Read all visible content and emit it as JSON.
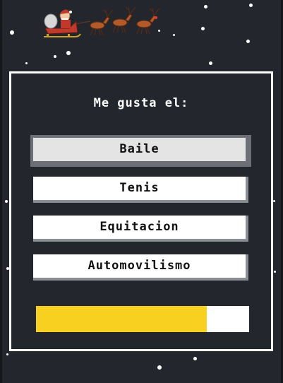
{
  "banner": {
    "icon": "santa-sleigh-reindeer-icon"
  },
  "quiz": {
    "question": "Me gusta el:",
    "options": [
      {
        "label": "Baile",
        "selected": true
      },
      {
        "label": "Tenis",
        "selected": false
      },
      {
        "label": "Equitacion",
        "selected": false
      },
      {
        "label": "Automovilismo",
        "selected": false
      }
    ],
    "progress": 0.8
  },
  "colors": {
    "background": "#23262c",
    "panel_border": "#ffffff",
    "progress_fill": "#f8d01f",
    "progress_track": "#ffffff",
    "option_selected": "#e4e4e4"
  }
}
